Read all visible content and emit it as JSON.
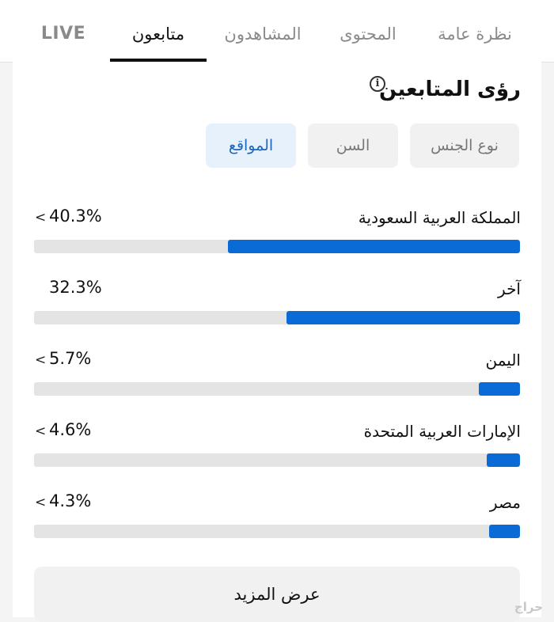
{
  "tabs": [
    {
      "label": "نظرة عامة",
      "active": false
    },
    {
      "label": "المحتوى",
      "active": false
    },
    {
      "label": "المشاهدون",
      "active": false
    },
    {
      "label": "متابعون",
      "active": true
    },
    {
      "label": "LIVE",
      "active": false
    }
  ],
  "section": {
    "title": "رؤى المتابعين",
    "info_icon": "info-icon"
  },
  "filters": [
    {
      "label": "نوع الجنس",
      "active": false
    },
    {
      "label": "السن",
      "active": false
    },
    {
      "label": "المواقع",
      "active": true
    }
  ],
  "locations": [
    {
      "name": "المملكة العربية السعودية",
      "value": "40.3%",
      "fraction": 0.403,
      "chevron": true
    },
    {
      "name": "آخر",
      "value": "32.3%",
      "fraction": 0.323,
      "chevron": false
    },
    {
      "name": "اليمن",
      "value": "5.7%",
      "fraction": 0.057,
      "chevron": true
    },
    {
      "name": "الإمارات العربية المتحدة",
      "value": "4.6%",
      "fraction": 0.046,
      "chevron": true
    },
    {
      "name": "مصر",
      "value": "4.3%",
      "fraction": 0.043,
      "chevron": true
    }
  ],
  "chevron_glyph": "<",
  "show_more": "عرض المزيد",
  "watermark": "حراج",
  "colors": {
    "bar_fill": "#0a6bd6",
    "bar_track": "#e4e4e4",
    "chip_active_text": "#1a66c4",
    "chip_active_bg": "#e6f1fb"
  }
}
